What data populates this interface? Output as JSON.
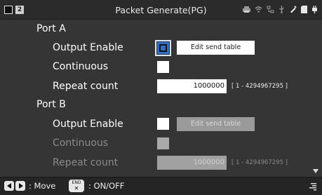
{
  "header": {
    "indicator_2": "2",
    "title": "Packet Generate(PG)",
    "status_icons": [
      "printer-icon",
      "wifi-icon",
      "network-icon",
      "usb-icon",
      "pen-icon",
      "sdcard-icon",
      "power-plug-icon"
    ]
  },
  "port_a": {
    "label": "Port A",
    "output_enable": {
      "label": "Output Enable",
      "checked": true,
      "button_label": "Edit send table"
    },
    "continuous": {
      "label": "Continuous",
      "checked": false
    },
    "repeat_count": {
      "label": "Repeat count",
      "value": "1000000",
      "range": "[ 1 - 4294967295 ]"
    }
  },
  "port_b": {
    "label": "Port B",
    "output_enable": {
      "label": "Output Enable",
      "checked": false,
      "button_label": "Edit send table"
    },
    "continuous": {
      "label": "Continuous",
      "checked": false
    },
    "repeat_count": {
      "label": "Repeat count",
      "value": "1000000",
      "range": "[ 1 - 4294967295 ]"
    }
  },
  "footer": {
    "move_label": ": Move",
    "key_label_top": "END",
    "key_label_bottom": "✕",
    "toggle_label": ": ON/OFF"
  },
  "colors": {
    "background": "#353535",
    "focus": "#2f6fc7",
    "disabled": "#a0a0a0"
  }
}
